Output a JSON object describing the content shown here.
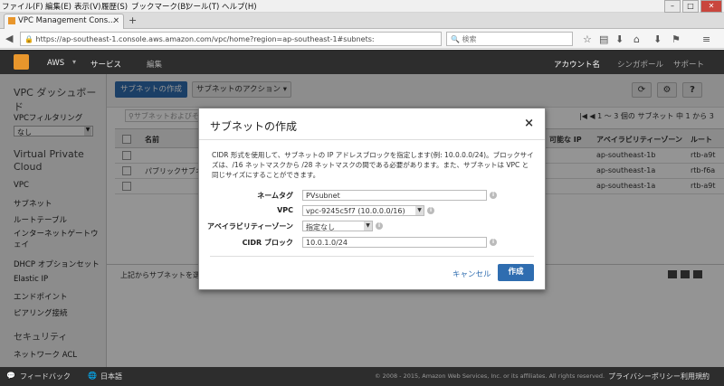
{
  "browser": {
    "menu": [
      "ファイル(F)",
      "編集(E)",
      "表示(V)",
      "履歴(S)",
      "ブックマーク(B)",
      "ツール(T)",
      "ヘルプ(H)"
    ],
    "tab_title": "VPC Management Cons...",
    "new_tab": "+",
    "url": "https://ap-southeast-1.console.aws.amazon.com/vpc/home?region=ap-southeast-1#subnets:",
    "search_placeholder": "検索"
  },
  "aws_header": {
    "aws": "AWS",
    "services": "サービス",
    "edit": "編集",
    "account": "アカウント名",
    "region": "シンガポール",
    "support": "サポート"
  },
  "sidebar": {
    "dashboard": "VPC ダッシュボード",
    "filter_label": "VPCフィルタリング",
    "filter_value": "なし",
    "section_vpc": "Virtual Private Cloud",
    "items": [
      "VPC",
      "サブネット",
      "ルートテーブル",
      "インターネットゲートウェイ",
      "DHCP オプションセット",
      "Elastic IP",
      "エンドポイント",
      "ピアリング接続"
    ],
    "section_security": "セキュリティ",
    "security_items": [
      "ネットワーク ACL"
    ]
  },
  "toolbar": {
    "create_subnet": "サブネットの作成",
    "subnet_actions": "サブネットのアクション",
    "search_placeholder": "サブネットおよびその",
    "pagination": "1 ～ 3 個の サブネット 中 1 から 3"
  },
  "table": {
    "headers": [
      "名前",
      "可能な IP",
      "アベイラビリティーゾーン",
      "ルート"
    ],
    "rows": [
      {
        "name": "",
        "az": "ap-southeast-1b",
        "route": "rtb-a9t"
      },
      {
        "name": "パブリックサブネット",
        "az": "ap-southeast-1a",
        "route": "rtb-f6a"
      },
      {
        "name": "",
        "az": "ap-southeast-1a",
        "route": "rtb-a9t"
      }
    ],
    "detail_text": "上記からサブネットを選"
  },
  "modal": {
    "title": "サブネットの作成",
    "close": "×",
    "description": "CIDR 形式を使用して、サブネットの IP アドレスブロックを指定します(例: 10.0.0.0/24)。ブロックサイズは、/16 ネットマスクから /28 ネットマスクの間である必要があります。また、サブネットは VPC と同じサイズにすることができます。",
    "fields": {
      "name_tag_label": "ネームタグ",
      "name_tag_value": "PVsubnet",
      "vpc_label": "VPC",
      "vpc_value": "vpc-9245c5f7 (10.0.0.0/16)",
      "az_label": "アベイラビリティーゾーン",
      "az_value": "指定なし",
      "cidr_label": "CIDR ブロック",
      "cidr_value": "10.0.1.0/24"
    },
    "cancel": "キャンセル",
    "create": "作成"
  },
  "footer": {
    "feedback": "フィードバック",
    "language": "日本語",
    "copyright": "© 2008 - 2015, Amazon Web Services, Inc. or its affiliates. All rights reserved.",
    "privacy": "プライバシーポリシー",
    "terms": "利用規約"
  },
  "colors": {
    "primary": "#2f6db0",
    "header": "#2d2d2d",
    "aws_orange": "#e8962c"
  }
}
